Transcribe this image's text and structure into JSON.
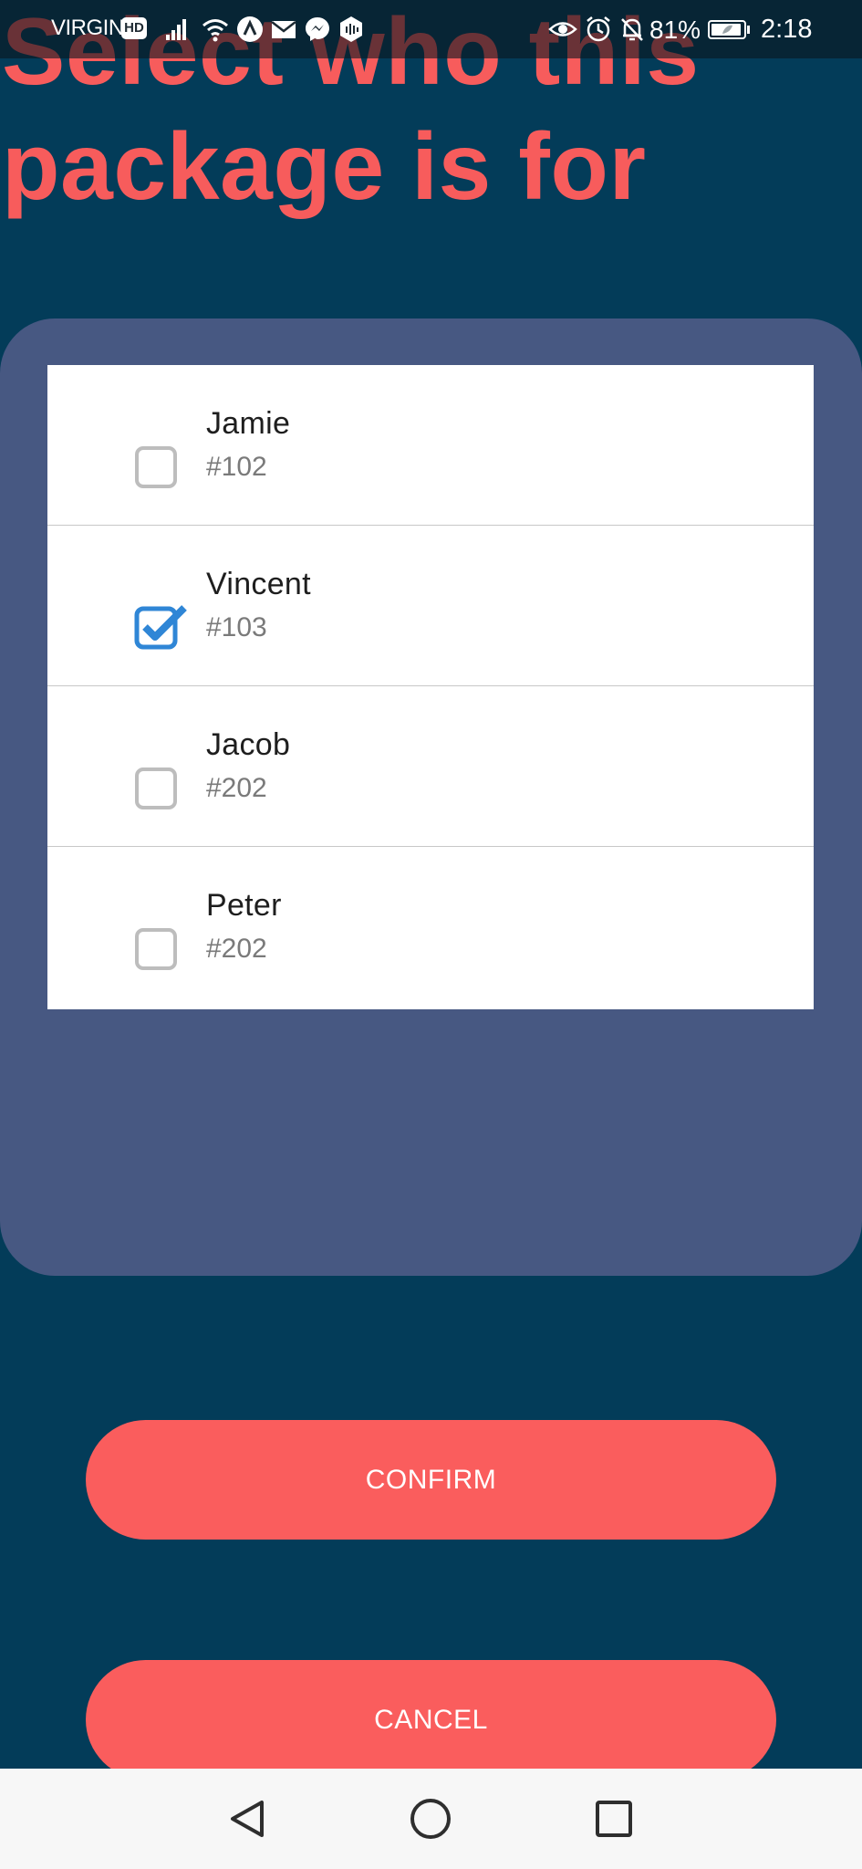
{
  "status_bar": {
    "carrier": "VIRGIN",
    "hd_badge": "HD",
    "battery_percent": "81%",
    "time": "2:18",
    "icons": [
      "signal-icon",
      "wifi-icon",
      "arrow-app-icon",
      "mail-icon",
      "messenger-icon",
      "podcast-icon",
      "eye-icon",
      "alarm-icon",
      "bell-off-icon",
      "battery-icon"
    ]
  },
  "page": {
    "title": "Select who this package is for"
  },
  "recipients": [
    {
      "name": "Jamie",
      "unit": "#102",
      "checked": false
    },
    {
      "name": "Vincent",
      "unit": "#103",
      "checked": true
    },
    {
      "name": "Jacob",
      "unit": "#202",
      "checked": false
    },
    {
      "name": "Peter",
      "unit": "#202",
      "checked": false
    }
  ],
  "actions": {
    "confirm_label": "CONFIRM",
    "cancel_label": "CANCEL"
  },
  "nav_bar": {
    "icons": [
      "back-triangle-icon",
      "home-circle-icon",
      "recents-square-icon"
    ]
  },
  "colors": {
    "background": "#033c59",
    "panel": "#475882",
    "accent": "#fa5d5d",
    "checkbox_checked": "#2f86d6",
    "checkbox_unchecked": "#bdbdbd"
  }
}
